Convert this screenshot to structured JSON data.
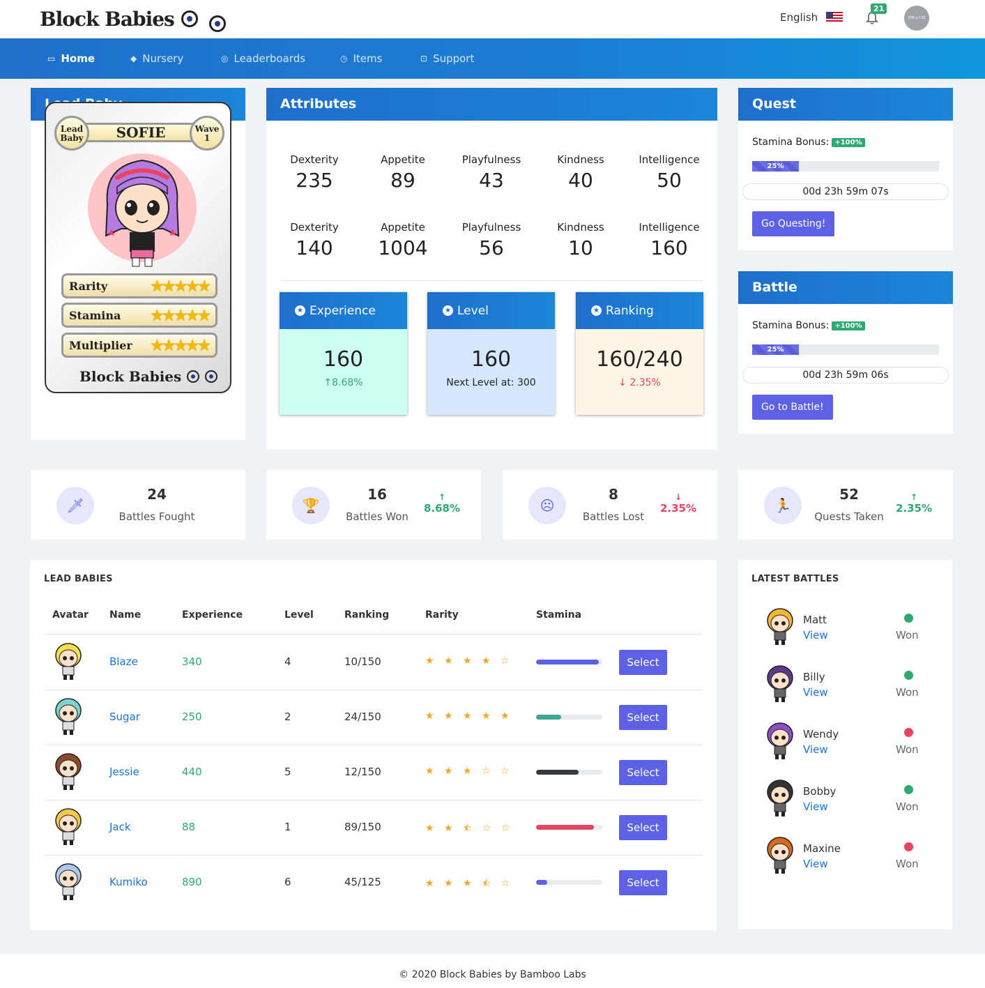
{
  "header": {
    "logo_text": "Block Babies",
    "language": "English",
    "notifications_count": "21",
    "avatar_text": "136 x 136"
  },
  "nav": [
    {
      "label": "Home",
      "icon": "monitor-icon",
      "active": true
    },
    {
      "label": "Nursery",
      "icon": "diamond-icon"
    },
    {
      "label": "Leaderboards",
      "icon": "target-icon"
    },
    {
      "label": "Items",
      "icon": "clock-icon"
    },
    {
      "label": "Support",
      "icon": "square-icon"
    }
  ],
  "lead_baby": {
    "title": "Lead Baby",
    "card_badge_left": "Lead Baby",
    "name": "SOFIE",
    "card_badge_right": "Wave 1",
    "rarity_label": "Rarity",
    "stamina_label": "Stamina",
    "multiplier_label": "Multiplier",
    "stars": "★★★★★",
    "card_logo": "Block Babies"
  },
  "attributes": {
    "title": "Attributes",
    "row1": [
      {
        "label": "Dexterity",
        "value": "235"
      },
      {
        "label": "Appetite",
        "value": "89"
      },
      {
        "label": "Playfulness",
        "value": "43"
      },
      {
        "label": "Kindness",
        "value": "40"
      },
      {
        "label": "Intelligence",
        "value": "50"
      }
    ],
    "row2": [
      {
        "label": "Dexterity",
        "value": "140"
      },
      {
        "label": "Appetite",
        "value": "1004"
      },
      {
        "label": "Playfulness",
        "value": "56"
      },
      {
        "label": "Kindness",
        "value": "10"
      },
      {
        "label": "Intelligence",
        "value": "160"
      }
    ],
    "experience": {
      "label": "Experience",
      "value": "160",
      "delta": "8.68%",
      "color": "#ccfff1"
    },
    "level": {
      "label": "Level",
      "value": "160",
      "sub": "Next Level at: 300",
      "color": "#d6e8ff"
    },
    "ranking": {
      "label": "Ranking",
      "value": "160/240",
      "delta": "2.35%",
      "color": "#fff4e6"
    }
  },
  "quest": {
    "title": "Quest",
    "stamina_label": "Stamina Bonus:",
    "bonus": "+100%",
    "progress_text": "25%",
    "progress": 0.25,
    "timer": "00d 23h 59m 07s",
    "button": "Go Questing!"
  },
  "battle": {
    "title": "Battle",
    "stamina_label": "Stamina Bonus:",
    "bonus": "+100%",
    "progress_text": "25%",
    "progress": 0.25,
    "timer": "00d 23h 59m 06s",
    "button": "Go to Battle!"
  },
  "stats": [
    {
      "value": "24",
      "label": "Battles Fought",
      "icon": "sword-icon"
    },
    {
      "value": "16",
      "label": "Battles Won",
      "delta": "8.68%",
      "direction": "up",
      "icon": "trophy-icon"
    },
    {
      "value": "8",
      "label": "Battles Lost",
      "delta": "2.35%",
      "direction": "down",
      "icon": "sad-face-icon"
    },
    {
      "value": "52",
      "label": "Quests Taken",
      "delta": "2.35%",
      "direction": "up",
      "icon": "running-icon"
    }
  ],
  "lead_babies": {
    "title": "LEAD BABIES",
    "columns": [
      "Avatar",
      "Name",
      "Experience",
      "Level",
      "Ranking",
      "Rarity",
      "Stamina"
    ],
    "select_label": "Select",
    "rows": [
      {
        "name": "Blaze",
        "experience": "340",
        "level": "4",
        "ranking": "10/150",
        "rarity": "★ ★ ★ ★ ☆",
        "stamina": 0.95,
        "stamina_color": "#5c61e6",
        "hair": "#f4e04d"
      },
      {
        "name": "Sugar",
        "experience": "250",
        "level": "2",
        "ranking": "24/150",
        "rarity": "★ ★ ★ ★ ★",
        "stamina": 0.38,
        "stamina_color": "#3aa88f",
        "hair": "#7ad3cf"
      },
      {
        "name": "Jessie",
        "experience": "440",
        "level": "5",
        "ranking": "12/150",
        "rarity": "★ ★ ★ ☆ ☆",
        "stamina": 0.64,
        "stamina_color": "#343a40",
        "hair": "#8b4a2b"
      },
      {
        "name": "Jack",
        "experience": "88",
        "level": "1",
        "ranking": "89/150",
        "rarity": "★ ★ ⯪ ☆ ☆",
        "stamina": 0.87,
        "stamina_color": "#e8445f",
        "hair": "#f3c94a"
      },
      {
        "name": "Kumiko",
        "experience": "890",
        "level": "6",
        "ranking": "45/125",
        "rarity": "★ ★ ★ ⯪ ☆",
        "stamina": 0.17,
        "stamina_color": "#5c61e6",
        "hair": "#a9c9ef"
      }
    ]
  },
  "latest_battles": {
    "title": "LATEST BATTLES",
    "view_label": "View",
    "rows": [
      {
        "name": "Matt",
        "result": "Won",
        "status_color": "#2fa96f",
        "hair": "#f2b632"
      },
      {
        "name": "Billy",
        "result": "Won",
        "status_color": "#2fa96f",
        "hair": "#5b3a8a"
      },
      {
        "name": "Wendy",
        "result": "Won",
        "status_color": "#e8445f",
        "hair": "#8a4fc9"
      },
      {
        "name": "Bobby",
        "result": "Won",
        "status_color": "#2fa96f",
        "hair": "#333333"
      },
      {
        "name": "Maxine",
        "result": "Won",
        "status_color": "#e8445f",
        "hair": "#d46a1e"
      }
    ]
  },
  "footer": {
    "text": "© 2020 Block Babies by Bamboo Labs"
  }
}
